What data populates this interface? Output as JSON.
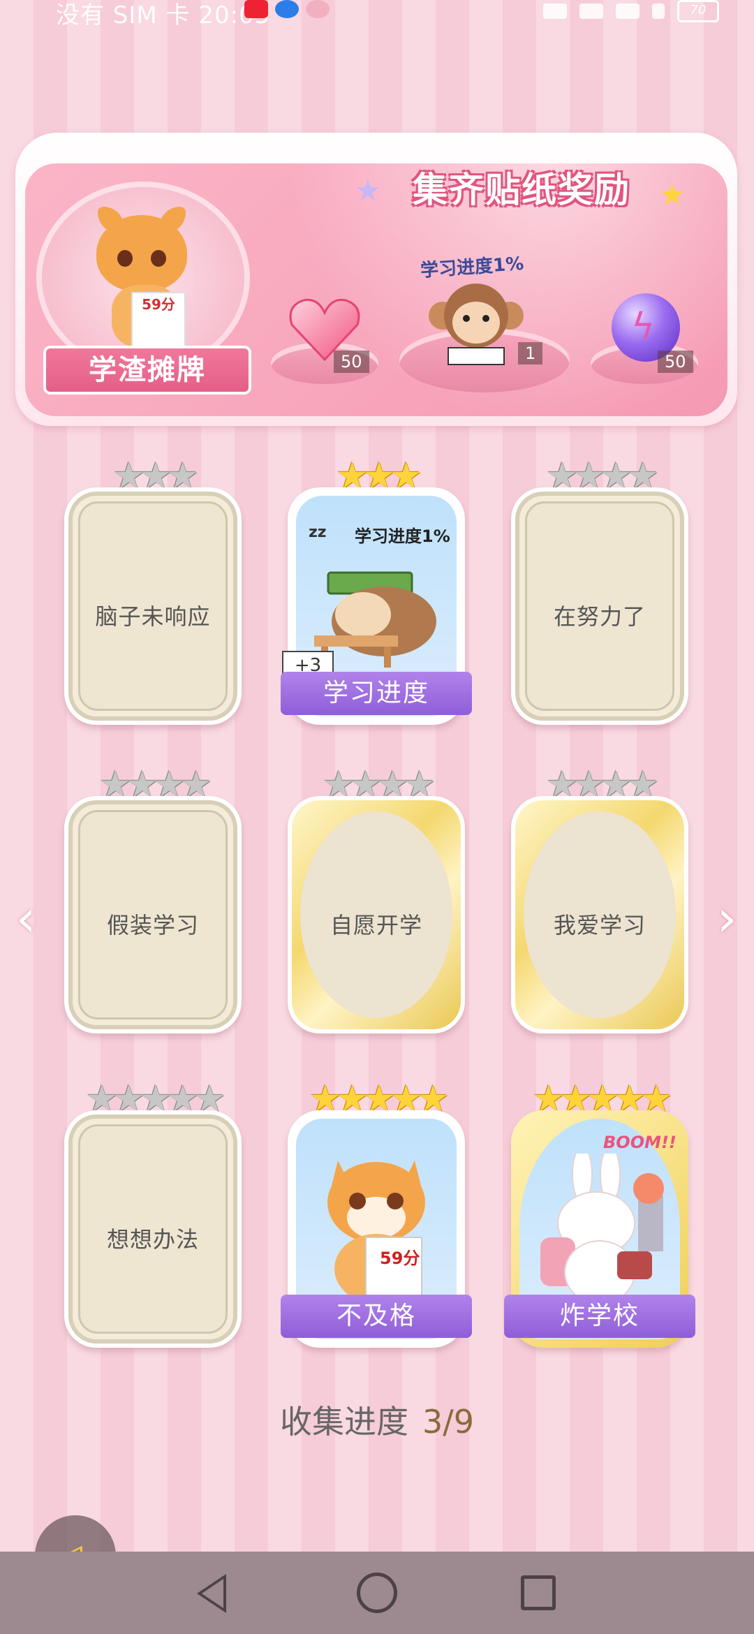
{
  "status_bar": {
    "carrier": "没有 SIM 卡",
    "time": "20:05",
    "battery": "70"
  },
  "banner": {
    "title": "集齐贴纸奖励",
    "avatar_label": "学渣摊牌",
    "tiger_score": "59分",
    "progress_tag": "学习进度1%",
    "rewards": [
      {
        "icon": "heart-gem-icon",
        "count": "50"
      },
      {
        "icon": "monkey-sticker-icon",
        "count": "1"
      },
      {
        "icon": "lightning-orb-icon",
        "count": "50"
      }
    ]
  },
  "cards": [
    {
      "label": "脑子未响应",
      "stars": 3,
      "star_color": "silver",
      "state": "locked"
    },
    {
      "label": "学习进度",
      "stars": 3,
      "star_color": "gold",
      "state": "collected",
      "badge": "+3",
      "caption": "学习进度1%"
    },
    {
      "label": "在努力了",
      "stars": 4,
      "star_color": "silver",
      "state": "locked"
    },
    {
      "label": "假装学习",
      "stars": 4,
      "star_color": "silver",
      "state": "locked"
    },
    {
      "label": "自愿开学",
      "stars": 4,
      "star_color": "silver",
      "state": "locked-gold"
    },
    {
      "label": "我爱学习",
      "stars": 4,
      "star_color": "silver",
      "state": "locked-gold"
    },
    {
      "label": "想想办法",
      "stars": 5,
      "star_color": "silver",
      "state": "locked"
    },
    {
      "label": "不及格",
      "stars": 5,
      "star_color": "gold",
      "state": "collected",
      "caption": "59分"
    },
    {
      "label": "炸学校",
      "stars": 5,
      "star_color": "gold",
      "state": "collected",
      "caption": "BOOM!!"
    }
  ],
  "collection": {
    "label": "收集进度",
    "value": "3/9"
  },
  "colors": {
    "accent": "#f07a9c",
    "purple_ribbon": "#9b6be0",
    "gold": "#f0cf55"
  }
}
